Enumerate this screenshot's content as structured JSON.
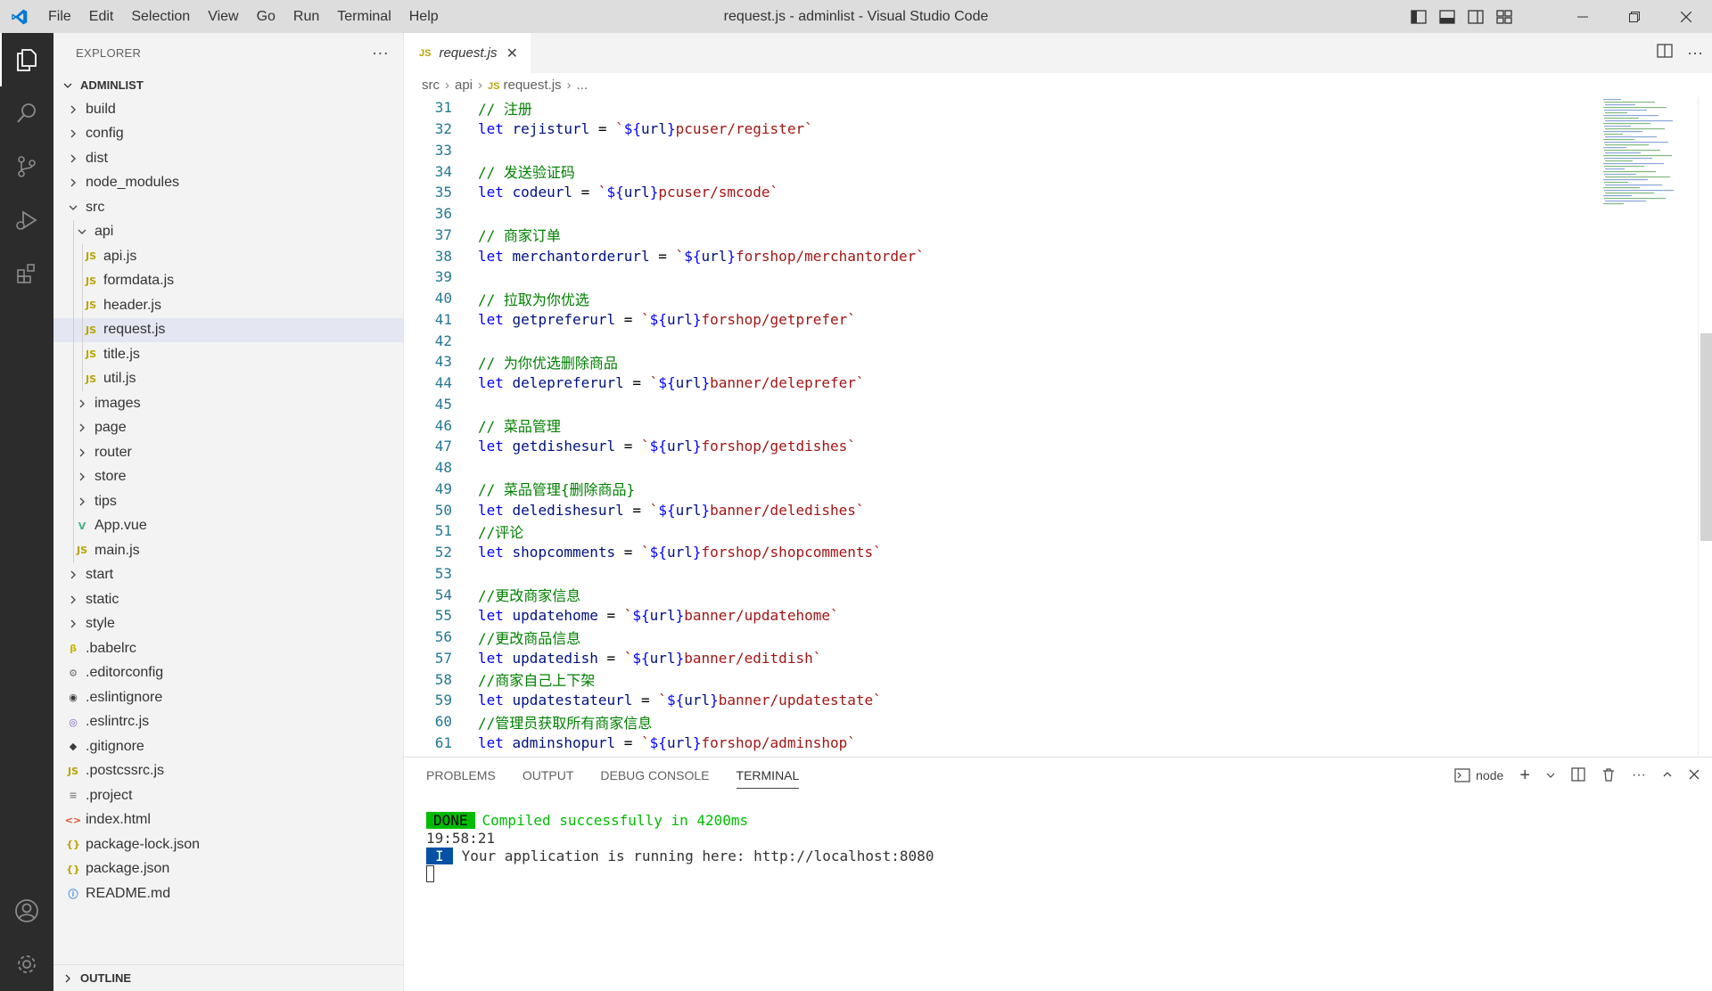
{
  "titlebar": {
    "menu": [
      "File",
      "Edit",
      "Selection",
      "View",
      "Go",
      "Run",
      "Terminal",
      "Help"
    ],
    "title": "request.js - adminlist - Visual Studio Code"
  },
  "explorer": {
    "header": "EXPLORER",
    "root": "ADMINLIST",
    "items": [
      {
        "label": "build",
        "type": "folder",
        "depth": 0
      },
      {
        "label": "config",
        "type": "folder",
        "depth": 0
      },
      {
        "label": "dist",
        "type": "folder",
        "depth": 0
      },
      {
        "label": "node_modules",
        "type": "folder",
        "depth": 0
      },
      {
        "label": "src",
        "type": "folder-open",
        "depth": 0
      },
      {
        "label": "api",
        "type": "folder-open",
        "depth": 1
      },
      {
        "label": "api.js",
        "type": "js",
        "depth": 2
      },
      {
        "label": "formdata.js",
        "type": "js",
        "depth": 2
      },
      {
        "label": "header.js",
        "type": "js",
        "depth": 2
      },
      {
        "label": "request.js",
        "type": "js",
        "depth": 2,
        "selected": true
      },
      {
        "label": "title.js",
        "type": "js",
        "depth": 2
      },
      {
        "label": "util.js",
        "type": "js",
        "depth": 2
      },
      {
        "label": "images",
        "type": "folder",
        "depth": 1
      },
      {
        "label": "page",
        "type": "folder",
        "depth": 1
      },
      {
        "label": "router",
        "type": "folder",
        "depth": 1
      },
      {
        "label": "store",
        "type": "folder",
        "depth": 1
      },
      {
        "label": "tips",
        "type": "folder",
        "depth": 1
      },
      {
        "label": "App.vue",
        "type": "vue",
        "depth": 1
      },
      {
        "label": "main.js",
        "type": "js",
        "depth": 1
      },
      {
        "label": "start",
        "type": "folder",
        "depth": 0
      },
      {
        "label": "static",
        "type": "folder",
        "depth": 0
      },
      {
        "label": "style",
        "type": "folder",
        "depth": 0
      },
      {
        "label": ".babelrc",
        "type": "babel",
        "depth": 0
      },
      {
        "label": ".editorconfig",
        "type": "gear",
        "depth": 0
      },
      {
        "label": ".eslintignore",
        "type": "circle",
        "depth": 0
      },
      {
        "label": ".eslintrc.js",
        "type": "eslint",
        "depth": 0
      },
      {
        "label": ".gitignore",
        "type": "git",
        "depth": 0
      },
      {
        "label": ".postcssrc.js",
        "type": "js",
        "depth": 0
      },
      {
        "label": ".project",
        "type": "text",
        "depth": 0
      },
      {
        "label": "index.html",
        "type": "html",
        "depth": 0
      },
      {
        "label": "package-lock.json",
        "type": "json",
        "depth": 0
      },
      {
        "label": "package.json",
        "type": "json",
        "depth": 0
      },
      {
        "label": "README.md",
        "type": "info",
        "depth": 0
      }
    ],
    "outline": "OUTLINE"
  },
  "editor": {
    "tab": {
      "label": "request.js",
      "icon": "JS"
    },
    "breadcrumb": [
      "src",
      "api",
      "request.js",
      "..."
    ],
    "lines": [
      {
        "n": "31",
        "tokens": [
          {
            "t": "// 注册",
            "c": "cm"
          }
        ]
      },
      {
        "n": "32",
        "tokens": [
          {
            "t": "let",
            "c": "kw"
          },
          {
            "t": " rejisturl ",
            "c": "vr"
          },
          {
            "t": "=",
            "c": "op"
          },
          {
            "t": " `",
            "c": "st"
          },
          {
            "t": "${",
            "c": "tp"
          },
          {
            "t": "url",
            "c": "ti"
          },
          {
            "t": "}",
            "c": "tp"
          },
          {
            "t": "pcuser/register`",
            "c": "st"
          }
        ]
      },
      {
        "n": "33",
        "tokens": []
      },
      {
        "n": "34",
        "tokens": [
          {
            "t": "// 发送验证码",
            "c": "cm"
          }
        ]
      },
      {
        "n": "35",
        "tokens": [
          {
            "t": "let",
            "c": "kw"
          },
          {
            "t": " codeurl ",
            "c": "vr"
          },
          {
            "t": "=",
            "c": "op"
          },
          {
            "t": " `",
            "c": "st"
          },
          {
            "t": "${",
            "c": "tp"
          },
          {
            "t": "url",
            "c": "ti"
          },
          {
            "t": "}",
            "c": "tp"
          },
          {
            "t": "pcuser/smcode`",
            "c": "st"
          }
        ]
      },
      {
        "n": "36",
        "tokens": []
      },
      {
        "n": "37",
        "tokens": [
          {
            "t": "// 商家订单",
            "c": "cm"
          }
        ]
      },
      {
        "n": "38",
        "tokens": [
          {
            "t": "let",
            "c": "kw"
          },
          {
            "t": " merchantorderurl ",
            "c": "vr"
          },
          {
            "t": "=",
            "c": "op"
          },
          {
            "t": " `",
            "c": "st"
          },
          {
            "t": "${",
            "c": "tp"
          },
          {
            "t": "url",
            "c": "ti"
          },
          {
            "t": "}",
            "c": "tp"
          },
          {
            "t": "forshop/merchantorder`",
            "c": "st"
          }
        ]
      },
      {
        "n": "39",
        "tokens": []
      },
      {
        "n": "40",
        "tokens": [
          {
            "t": "// 拉取为你优选",
            "c": "cm"
          }
        ]
      },
      {
        "n": "41",
        "tokens": [
          {
            "t": "let",
            "c": "kw"
          },
          {
            "t": " getpreferurl ",
            "c": "vr"
          },
          {
            "t": "=",
            "c": "op"
          },
          {
            "t": " `",
            "c": "st"
          },
          {
            "t": "${",
            "c": "tp"
          },
          {
            "t": "url",
            "c": "ti"
          },
          {
            "t": "}",
            "c": "tp"
          },
          {
            "t": "forshop/getprefer`",
            "c": "st"
          }
        ]
      },
      {
        "n": "42",
        "tokens": []
      },
      {
        "n": "43",
        "tokens": [
          {
            "t": "// 为你优选删除商品",
            "c": "cm"
          }
        ]
      },
      {
        "n": "44",
        "tokens": [
          {
            "t": "let",
            "c": "kw"
          },
          {
            "t": " delepreferurl ",
            "c": "vr"
          },
          {
            "t": "=",
            "c": "op"
          },
          {
            "t": " `",
            "c": "st"
          },
          {
            "t": "${",
            "c": "tp"
          },
          {
            "t": "url",
            "c": "ti"
          },
          {
            "t": "}",
            "c": "tp"
          },
          {
            "t": "banner/deleprefer`",
            "c": "st"
          }
        ]
      },
      {
        "n": "45",
        "tokens": []
      },
      {
        "n": "46",
        "tokens": [
          {
            "t": "// 菜品管理",
            "c": "cm"
          }
        ]
      },
      {
        "n": "47",
        "tokens": [
          {
            "t": "let",
            "c": "kw"
          },
          {
            "t": " getdishesurl ",
            "c": "vr"
          },
          {
            "t": "=",
            "c": "op"
          },
          {
            "t": " `",
            "c": "st"
          },
          {
            "t": "${",
            "c": "tp"
          },
          {
            "t": "url",
            "c": "ti"
          },
          {
            "t": "}",
            "c": "tp"
          },
          {
            "t": "forshop/getdishes`",
            "c": "st"
          }
        ]
      },
      {
        "n": "48",
        "tokens": []
      },
      {
        "n": "49",
        "tokens": [
          {
            "t": "// 菜品管理{删除商品}",
            "c": "cm"
          }
        ]
      },
      {
        "n": "50",
        "tokens": [
          {
            "t": "let",
            "c": "kw"
          },
          {
            "t": " deledishesurl ",
            "c": "vr"
          },
          {
            "t": "=",
            "c": "op"
          },
          {
            "t": " `",
            "c": "st"
          },
          {
            "t": "${",
            "c": "tp"
          },
          {
            "t": "url",
            "c": "ti"
          },
          {
            "t": "}",
            "c": "tp"
          },
          {
            "t": "banner/deledishes`",
            "c": "st"
          }
        ]
      },
      {
        "n": "51",
        "tokens": [
          {
            "t": "//评论",
            "c": "cm"
          }
        ]
      },
      {
        "n": "52",
        "tokens": [
          {
            "t": "let",
            "c": "kw"
          },
          {
            "t": " shopcomments ",
            "c": "vr"
          },
          {
            "t": "=",
            "c": "op"
          },
          {
            "t": " `",
            "c": "st"
          },
          {
            "t": "${",
            "c": "tp"
          },
          {
            "t": "url",
            "c": "ti"
          },
          {
            "t": "}",
            "c": "tp"
          },
          {
            "t": "forshop/shopcomments`",
            "c": "st"
          }
        ]
      },
      {
        "n": "53",
        "tokens": []
      },
      {
        "n": "54",
        "tokens": [
          {
            "t": "//更改商家信息",
            "c": "cm"
          }
        ]
      },
      {
        "n": "55",
        "tokens": [
          {
            "t": "let",
            "c": "kw"
          },
          {
            "t": " updatehome ",
            "c": "vr"
          },
          {
            "t": "=",
            "c": "op"
          },
          {
            "t": " `",
            "c": "st"
          },
          {
            "t": "${",
            "c": "tp"
          },
          {
            "t": "url",
            "c": "ti"
          },
          {
            "t": "}",
            "c": "tp"
          },
          {
            "t": "banner/updatehome`",
            "c": "st"
          }
        ]
      },
      {
        "n": "56",
        "tokens": [
          {
            "t": "//更改商品信息",
            "c": "cm"
          }
        ]
      },
      {
        "n": "57",
        "tokens": [
          {
            "t": "let",
            "c": "kw"
          },
          {
            "t": " updatedish ",
            "c": "vr"
          },
          {
            "t": "=",
            "c": "op"
          },
          {
            "t": " `",
            "c": "st"
          },
          {
            "t": "${",
            "c": "tp"
          },
          {
            "t": "url",
            "c": "ti"
          },
          {
            "t": "}",
            "c": "tp"
          },
          {
            "t": "banner/editdish`",
            "c": "st"
          }
        ]
      },
      {
        "n": "58",
        "tokens": [
          {
            "t": "//商家自己上下架",
            "c": "cm"
          }
        ]
      },
      {
        "n": "59",
        "tokens": [
          {
            "t": "let",
            "c": "kw"
          },
          {
            "t": " updatestateurl ",
            "c": "vr"
          },
          {
            "t": "=",
            "c": "op"
          },
          {
            "t": " `",
            "c": "st"
          },
          {
            "t": "${",
            "c": "tp"
          },
          {
            "t": "url",
            "c": "ti"
          },
          {
            "t": "}",
            "c": "tp"
          },
          {
            "t": "banner/updatestate`",
            "c": "st"
          }
        ]
      },
      {
        "n": "60",
        "tokens": [
          {
            "t": "//管理员获取所有商家信息",
            "c": "cm"
          }
        ]
      },
      {
        "n": "61",
        "tokens": [
          {
            "t": "let",
            "c": "kw"
          },
          {
            "t": " adminshopurl ",
            "c": "vr"
          },
          {
            "t": "=",
            "c": "op"
          },
          {
            "t": " `",
            "c": "st"
          },
          {
            "t": "${",
            "c": "tp"
          },
          {
            "t": "url",
            "c": "ti"
          },
          {
            "t": "}",
            "c": "tp"
          },
          {
            "t": "forshop/adminshop`",
            "c": "st"
          }
        ]
      }
    ]
  },
  "panel": {
    "tabs": [
      "PROBLEMS",
      "OUTPUT",
      "DEBUG CONSOLE",
      "TERMINAL"
    ],
    "active_tab": "TERMINAL",
    "terminal_name": "node",
    "terminal": {
      "done_badge": "DONE",
      "compiled": "Compiled successfully in 4200ms",
      "time": "19:58:21",
      "info_badge": "I",
      "running": "Your application is running here: http://localhost:8080"
    }
  },
  "colors": {
    "activity_bar": "#2c2c2c",
    "sidebar": "#f3f3f3",
    "titlebar": "#dddddd",
    "selected_row": "#e4e6f1",
    "accent_blue": "#007acc"
  }
}
